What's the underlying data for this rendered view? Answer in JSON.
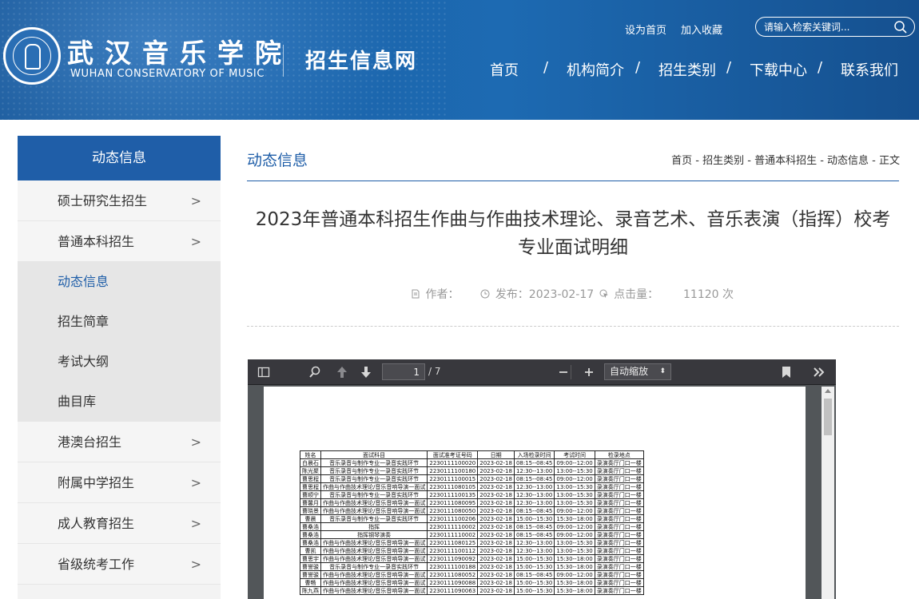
{
  "header": {
    "logo_cn": "武汉音乐学院",
    "logo_en": "WUHAN CONSERVATORY OF MUSIC",
    "site_name": "招生信息网",
    "links": {
      "set_home": "设为首页",
      "favorite": "加入收藏"
    },
    "search": {
      "placeholder": "请输入检索关键词..."
    },
    "nav": [
      {
        "label": "首页"
      },
      {
        "label": "机构简介"
      },
      {
        "label": "招生类别"
      },
      {
        "label": "下载中心"
      },
      {
        "label": "联系我们"
      }
    ],
    "nav_separator": "/"
  },
  "sidebar": {
    "title": "动态信息",
    "items": [
      {
        "label": "硕士研究生招生",
        "arrow": ">"
      },
      {
        "label": "普通本科招生",
        "arrow": ">"
      }
    ],
    "sub_items": [
      {
        "label": "动态信息"
      },
      {
        "label": "招生简章"
      },
      {
        "label": "考试大纲"
      },
      {
        "label": "曲目库"
      }
    ],
    "items_after": [
      {
        "label": "港澳台招生",
        "arrow": ">"
      },
      {
        "label": "附属中学招生",
        "arrow": ">"
      },
      {
        "label": "成人教育招生",
        "arrow": ">"
      },
      {
        "label": "省级统考工作",
        "arrow": ">"
      }
    ]
  },
  "main": {
    "section_title": "动态信息",
    "breadcrumb": "首页 - 招生类别 - 普通本科招生 - 动态信息 - 正文",
    "article_title": "2023年普通本科招生作曲与作曲技术理论、录音艺术、音乐表演（指挥）校考专业面试明细",
    "meta": {
      "author_label": "作者：",
      "publish_label": "发布：2023-02-17",
      "clicks_label": "点击量：",
      "clicks_value": "11120 次"
    }
  },
  "pdf_viewer": {
    "page_number": "1",
    "page_total": "/ 7",
    "zoom": "自动缩放",
    "table": {
      "headers": [
        "姓名",
        "面试科目",
        "面试准考证号码",
        "日期",
        "入场检录时间",
        "考试时间",
        "检录地点"
      ],
      "rows": [
        [
          "白晨石",
          "音乐录音与制作专业一录音实践环节",
          "2230111100020",
          "2023-02-18",
          "08:15--08:45",
          "09:00--12:00",
          "录演奏厅门口一楼"
        ],
        [
          "陈光聚",
          "音乐录音与制作专业一录音实践环节",
          "2230111100180",
          "2023-02-18",
          "12:30--13:00",
          "13:00--15:30",
          "录演奏厅门口一楼"
        ],
        [
          "曹思程",
          "音乐录音与制作专业一录音实践环节",
          "2230111100015",
          "2023-02-18",
          "08:15--08:45",
          "09:00--12:00",
          "录演奏厅门口一楼"
        ],
        [
          "曹思程",
          "作曲与作曲技术理论/音乐音响导演一面试",
          "2230111080105",
          "2023-02-18",
          "12:30--13:00",
          "13:00--15:30",
          "录演奏厅门口一楼"
        ],
        [
          "曹顺宁",
          "音乐录音与制作专业一录音实践环节",
          "2230111100135",
          "2023-02-18",
          "12:30--13:00",
          "13:00--15:30",
          "录演奏厅门口一楼"
        ],
        [
          "曹馨月",
          "作曲与作曲技术理论/音乐音响导演一面试",
          "2230111080095",
          "2023-02-18",
          "12:30--13:00",
          "13:00--15:30",
          "录演奏厅门口一楼"
        ],
        [
          "曹晓景",
          "作曲与作曲技术理论/音乐音响导演一面试",
          "2230111080050",
          "2023-02-18",
          "08:15--08:45",
          "09:00--12:00",
          "录演奏厅门口一楼"
        ],
        [
          "曹晨",
          "音乐录音与制作专业一录音实践环节",
          "2230111100206",
          "2023-02-18",
          "15:00--15:30",
          "15:30--18:00",
          "录演奏厅门口一楼"
        ],
        [
          "曹桑浩",
          "指挥",
          "2230111110002",
          "2023-02-18",
          "08:15--08:45",
          "09:00--12:00",
          "录演奏厅门口一楼"
        ],
        [
          "曹桑浩",
          "指挥钢琴演奏",
          "2230111110002",
          "2023-02-18",
          "08:15--08:45",
          "09:00--12:00",
          "录演奏厅门口一楼"
        ],
        [
          "曹桑浩",
          "作曲与作曲技术理论/音乐音响导演一面试",
          "2230111080125",
          "2023-02-18",
          "12:30--13:00",
          "13:00--15:30",
          "录演奏厅门口一楼"
        ],
        [
          "曹凯",
          "作曲与作曲技术理论/音乐音响导演一面试",
          "2230111100112",
          "2023-02-18",
          "12:30--13:00",
          "13:00--15:30",
          "录演奏厅门口一楼"
        ],
        [
          "曹思宇",
          "作曲与作曲技术理论/音乐音响导演一面试",
          "2230111090092",
          "2023-02-18",
          "15:00--15:30",
          "15:30--18:00",
          "录演奏厅门口一楼"
        ],
        [
          "曹誉骏",
          "音乐录音与制作专业一录音实践环节",
          "2230111100188",
          "2023-02-18",
          "15:00--15:30",
          "15:30--18:00",
          "录演奏厅门口一楼"
        ],
        [
          "曹誉骏",
          "作曲与作曲技术理论/音乐音响导演一面试",
          "2230111080052",
          "2023-02-18",
          "08:15--08:45",
          "09:00--12:00",
          "录演奏厅门口一楼"
        ],
        [
          "曹畅",
          "作曲与作曲技术理论/音乐音响导演一面试",
          "2230111090088",
          "2023-02-18",
          "15:00--15:30",
          "15:30--18:00",
          "录演奏厅门口一楼"
        ],
        [
          "陈九燕",
          "作曲与作曲技术理论/音乐音响导演一面试",
          "2230111090063",
          "2023-02-18",
          "15:00--15:30",
          "15:30--18:00",
          "录演奏厅门口一楼"
        ]
      ]
    }
  },
  "colors": {
    "brand_blue": "#1f5ea8",
    "header_blue": "#1b64ab"
  }
}
